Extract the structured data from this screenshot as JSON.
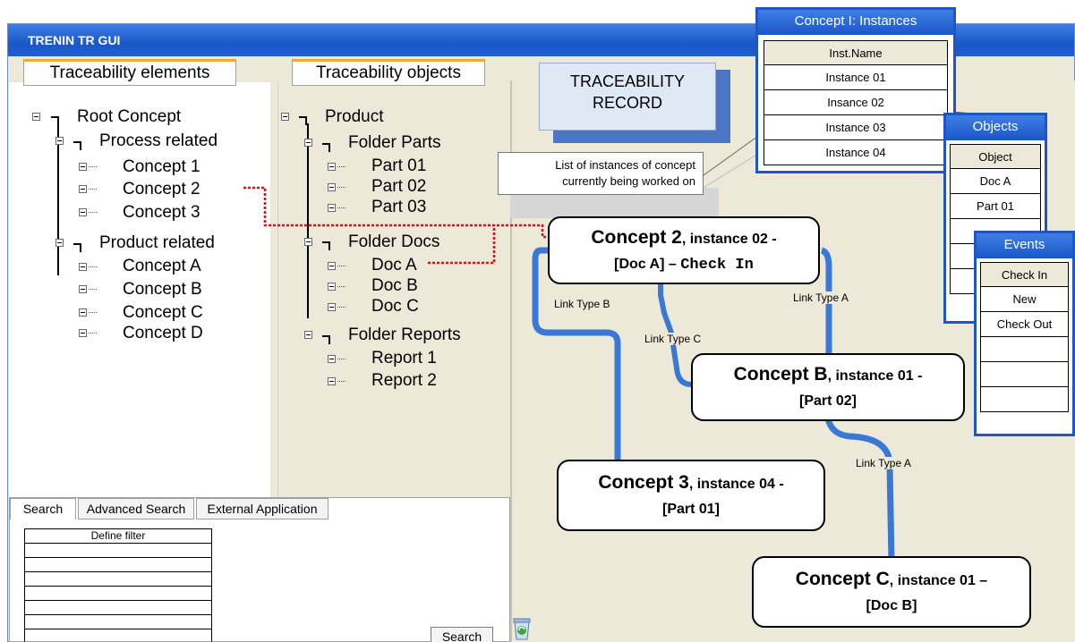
{
  "window": {
    "title": "TRENIN TR GUI"
  },
  "tabs": {
    "elements": "Traceability elements",
    "objects": "Traceability objects"
  },
  "elements_tree": {
    "root": "Root Concept",
    "process": "Process related",
    "process_children": [
      "Concept 1",
      "Concept 2",
      "Concept 3"
    ],
    "product": "Product related",
    "product_children": [
      "Concept A",
      "Concept B",
      "Concept C",
      "Concept D"
    ]
  },
  "objects_tree": {
    "root": "Product",
    "parts": "Folder Parts",
    "parts_children": [
      "Part 01",
      "Part 02",
      "Part 03"
    ],
    "docs": "Folder Docs",
    "docs_children": [
      "Doc A",
      "Doc B",
      "Doc C"
    ],
    "reports": "Folder Reports",
    "reports_children": [
      "Report 1",
      "Report 2"
    ]
  },
  "search": {
    "tabs": [
      "Search",
      "Advanced Search",
      "External Application"
    ],
    "filter_header": "Define filter",
    "button": "Search"
  },
  "record": {
    "title_line1": "TRACEABILITY",
    "title_line2": "RECORD",
    "callout_line1": "List of instances of concept",
    "callout_line2": "currently being worked on"
  },
  "nodes": {
    "main": {
      "concept": "Concept 2",
      "instance": ", instance 02 -",
      "object": "[Doc A] – ",
      "event": "Check In"
    },
    "b": {
      "concept": "Concept B",
      "instance": ", instance 01 -",
      "object": "[Part 02]"
    },
    "three": {
      "concept": "Concept 3",
      "instance": ", instance 04 -",
      "object": "[Part 01]"
    },
    "c": {
      "concept": "Concept C",
      "instance": ", instance 01 –",
      "object": "[Doc B]"
    }
  },
  "links": {
    "b": "Link Type B",
    "c": "Link Type C",
    "a1": "Link Type A",
    "a2": "Link Type A"
  },
  "instances_window": {
    "title": "Concept I: Instances",
    "header": "Inst.Name",
    "rows": [
      "Instance 01",
      "Insance 02",
      "Instance 03",
      "Instance 04"
    ]
  },
  "objects_window": {
    "title": "Objects",
    "header": "Object",
    "rows": [
      "Doc A",
      "Part 01"
    ]
  },
  "events_window": {
    "title": "Events",
    "rows": [
      "Check In",
      "New",
      "Check Out"
    ]
  },
  "colors": {
    "accent_blue": "#1f55c5",
    "link_blue": "#3a78d6",
    "pointer_red": "#e01010",
    "tab_orange": "#f3a73c"
  },
  "icons": [
    "recycle-bin-icon"
  ]
}
